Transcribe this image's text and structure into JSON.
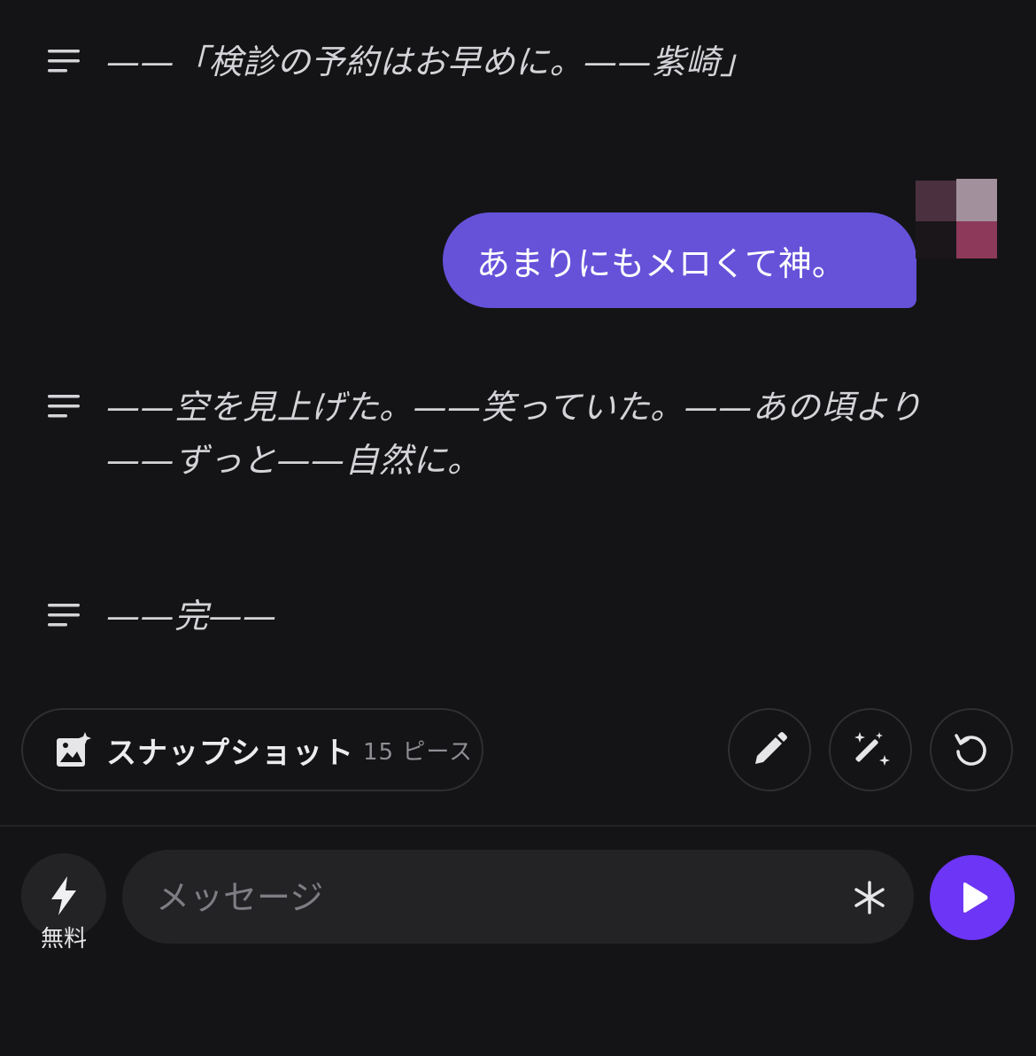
{
  "messages": [
    {
      "type": "narration",
      "text": "——「検診の予約はお早めに。——紫崎」"
    },
    {
      "type": "user",
      "text": "あまりにもメロくて神。"
    },
    {
      "type": "narration",
      "text": "——空を見上げた。——笑っていた。——あの頃より——ずっと——自然に。"
    },
    {
      "type": "narration",
      "text": "——完——"
    }
  ],
  "snapshot": {
    "label": "スナップショット",
    "count": "15 ピース"
  },
  "actions": {
    "edit_icon": "pencil-icon",
    "magic_icon": "magic-wand-icon",
    "regenerate_icon": "refresh-icon"
  },
  "composer": {
    "mode_icon": "lightning-icon",
    "mode_label": "無料",
    "placeholder": "メッセージ",
    "asterisk_icon": "asterisk-icon",
    "send_icon": "play-icon"
  },
  "colors": {
    "background": "#141416",
    "user_bubble": "#6552d9",
    "send_button": "#6d35f5"
  }
}
